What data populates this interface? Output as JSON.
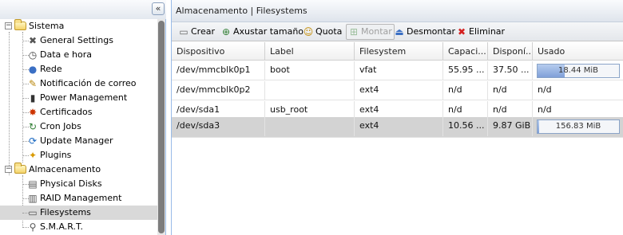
{
  "nav": {
    "collapse_glyph": "«",
    "sistema": {
      "label": "Sistema",
      "items": [
        {
          "label": "General Settings",
          "icon": "wrench-screwdriver-icon",
          "glyph": "✖",
          "color": "#555555"
        },
        {
          "label": "Data e hora",
          "icon": "clock-icon",
          "glyph": "◷",
          "color": "#444444"
        },
        {
          "label": "Rede",
          "icon": "network-globe-icon",
          "glyph": "●",
          "color": "#3a6fc4"
        },
        {
          "label": "Notificación de correo",
          "icon": "mail-pencil-icon",
          "glyph": "✎",
          "color": "#b8860b"
        },
        {
          "label": "Power Management",
          "icon": "power-plug-icon",
          "glyph": "▮",
          "color": "#333333"
        },
        {
          "label": "Certificados",
          "icon": "certificate-seal-icon",
          "glyph": "✸",
          "color": "#cc3300"
        },
        {
          "label": "Cron Jobs",
          "icon": "cron-refresh-icon",
          "glyph": "↻",
          "color": "#2e7d32"
        },
        {
          "label": "Update Manager",
          "icon": "update-manager-icon",
          "glyph": "⟳",
          "color": "#1565c0"
        },
        {
          "label": "Plugins",
          "icon": "puzzle-icon",
          "glyph": "✦",
          "color": "#d99a00"
        }
      ]
    },
    "almacenamento": {
      "label": "Almacenamento",
      "items": [
        {
          "label": "Physical Disks",
          "icon": "physical-disk-icon",
          "glyph": "▤",
          "color": "#555555"
        },
        {
          "label": "RAID Management",
          "icon": "raid-icon",
          "glyph": "▥",
          "color": "#555555"
        },
        {
          "label": "Filesystems",
          "icon": "filesystem-icon",
          "glyph": "▭",
          "color": "#555555"
        },
        {
          "label": "S.M.A.R.T.",
          "icon": "smart-search-icon",
          "glyph": "⚲",
          "color": "#555555"
        }
      ]
    }
  },
  "panel": {
    "title": "Almacenamento | Filesystems",
    "toolbar": [
      {
        "label": "Crear",
        "icon": "create-disk-icon",
        "glyph": "▭",
        "color": "#666666",
        "disabled": false
      },
      {
        "label": "Axustar tamaño",
        "icon": "resize-icon",
        "glyph": "⊕",
        "color": "#2e7d32",
        "disabled": false
      },
      {
        "label": "Quota",
        "icon": "quota-users-icon",
        "glyph": "☺",
        "color": "#c28a00",
        "disabled": false
      },
      {
        "label": "Montar",
        "icon": "mount-icon",
        "glyph": "⊞",
        "color": "#9cbf9c",
        "disabled": true
      },
      {
        "label": "Desmontar",
        "icon": "unmount-icon",
        "glyph": "⏏",
        "color": "#3a6fc4",
        "disabled": false
      },
      {
        "label": "Eliminar",
        "icon": "delete-x-icon",
        "glyph": "✖",
        "color": "#d42020",
        "disabled": false
      }
    ],
    "columns": [
      "Dispositivo",
      "Label",
      "Filesystem",
      "Capaci...",
      "Disponí...",
      "Usado"
    ],
    "rows": [
      {
        "device": "/dev/mmcblk0p1",
        "label": "boot",
        "fs": "vfat",
        "capacity": "55.95 ...",
        "available": "37.50 ...",
        "used": "18.44 MiB",
        "used_fraction": 0.33,
        "has_bar": true
      },
      {
        "device": "/dev/mmcblk0p2",
        "label": "",
        "fs": "ext4",
        "capacity": "n/d",
        "available": "n/d",
        "used": "n/d",
        "used_fraction": 0,
        "has_bar": false
      },
      {
        "device": "/dev/sda1",
        "label": "usb_root",
        "fs": "ext4",
        "capacity": "n/d",
        "available": "n/d",
        "used": "n/d",
        "used_fraction": 0,
        "has_bar": false
      },
      {
        "device": "/dev/sda3",
        "label": "",
        "fs": "ext4",
        "capacity": "10.56 ...",
        "available": "9.87 GiB",
        "used": "156.83 MiB",
        "used_fraction": 0.02,
        "has_bar": true
      }
    ]
  }
}
